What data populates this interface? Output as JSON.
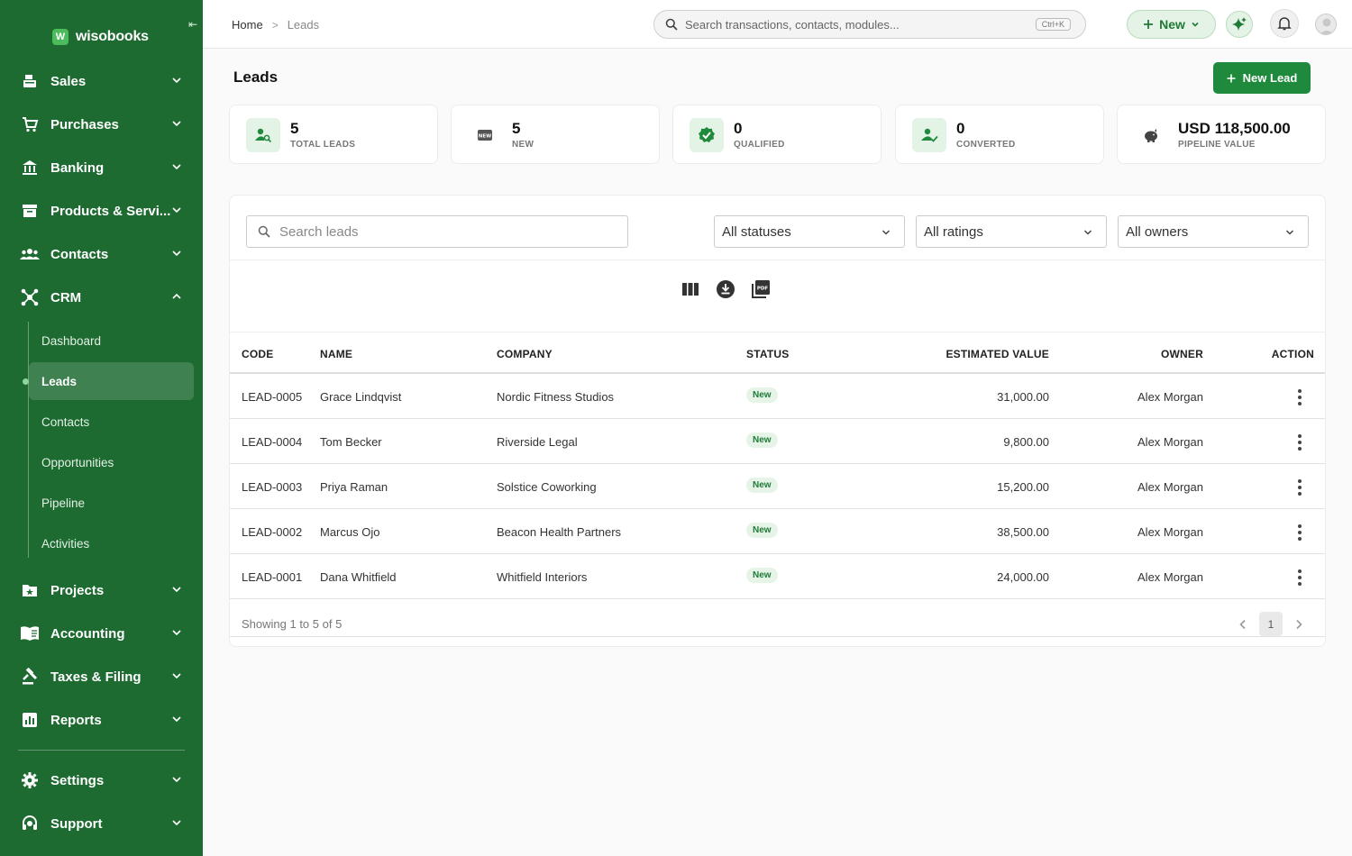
{
  "sidebar": {
    "logo_letter": "W",
    "logo_text": "wisobooks",
    "collapse_glyph": "⇤",
    "items": [
      {
        "label": "Sales",
        "icon": "register-icon"
      },
      {
        "label": "Purchases",
        "icon": "cart-icon"
      },
      {
        "label": "Banking",
        "icon": "bank-icon"
      },
      {
        "label": "Products & Servi...",
        "icon": "archive-icon"
      },
      {
        "label": "Contacts",
        "icon": "people-icon"
      },
      {
        "label": "CRM",
        "icon": "hub-icon"
      },
      {
        "label": "Projects",
        "icon": "folder-star-icon"
      },
      {
        "label": "Accounting",
        "icon": "ledger-icon"
      },
      {
        "label": "Taxes & Filing",
        "icon": "gavel-icon"
      },
      {
        "label": "Reports",
        "icon": "chart-icon"
      },
      {
        "label": "Settings",
        "icon": "gear-icon"
      },
      {
        "label": "Support",
        "icon": "headset-icon"
      }
    ],
    "crm_sub": [
      "Dashboard",
      "Leads",
      "Contacts",
      "Opportunities",
      "Pipeline",
      "Activities"
    ],
    "active_sub": "Leads"
  },
  "topbar": {
    "breadcrumb_home": "Home",
    "breadcrumb_sep": ">",
    "breadcrumb_current": "Leads",
    "search_placeholder": "Search transactions, contacts, modules...",
    "search_shortcut": "Ctrl+K",
    "new_label": "New"
  },
  "page": {
    "title": "Leads",
    "new_lead_label": "New Lead"
  },
  "stats": [
    {
      "value": "5",
      "label": "TOTAL LEADS",
      "icon": "person-search-icon"
    },
    {
      "value": "5",
      "label": "NEW",
      "icon": "new-badge-icon"
    },
    {
      "value": "0",
      "label": "QUALIFIED",
      "icon": "verified-icon"
    },
    {
      "value": "0",
      "label": "CONVERTED",
      "icon": "person-check-icon"
    },
    {
      "value": "USD 118,500.00",
      "label": "PIPELINE VALUE",
      "icon": "piggy-bank-icon"
    }
  ],
  "filters": {
    "search_placeholder": "Search leads",
    "status": "All statuses",
    "rating": "All ratings",
    "owner": "All owners"
  },
  "table": {
    "columns": [
      "CODE",
      "NAME",
      "COMPANY",
      "STATUS",
      "ESTIMATED VALUE",
      "OWNER",
      "ACTION"
    ],
    "rows": [
      {
        "code": "LEAD-0005",
        "name": "Grace Lindqvist",
        "company": "Nordic Fitness Studios",
        "status": "New",
        "value": "31,000.00",
        "owner": "Alex Morgan"
      },
      {
        "code": "LEAD-0004",
        "name": "Tom Becker",
        "company": "Riverside Legal",
        "status": "New",
        "value": "9,800.00",
        "owner": "Alex Morgan"
      },
      {
        "code": "LEAD-0003",
        "name": "Priya Raman",
        "company": "Solstice Coworking",
        "status": "New",
        "value": "15,200.00",
        "owner": "Alex Morgan"
      },
      {
        "code": "LEAD-0002",
        "name": "Marcus Ojo",
        "company": "Beacon Health Partners",
        "status": "New",
        "value": "38,500.00",
        "owner": "Alex Morgan"
      },
      {
        "code": "LEAD-0001",
        "name": "Dana Whitfield",
        "company": "Whitfield Interiors",
        "status": "New",
        "value": "24,000.00",
        "owner": "Alex Morgan"
      }
    ]
  },
  "footer": {
    "showing": "Showing 1 to 5 of 5",
    "page": "1"
  },
  "colors": {
    "sidebar": "#1e6b32",
    "accent": "#1f8a3c",
    "badge_bg": "#e6f4e8"
  }
}
